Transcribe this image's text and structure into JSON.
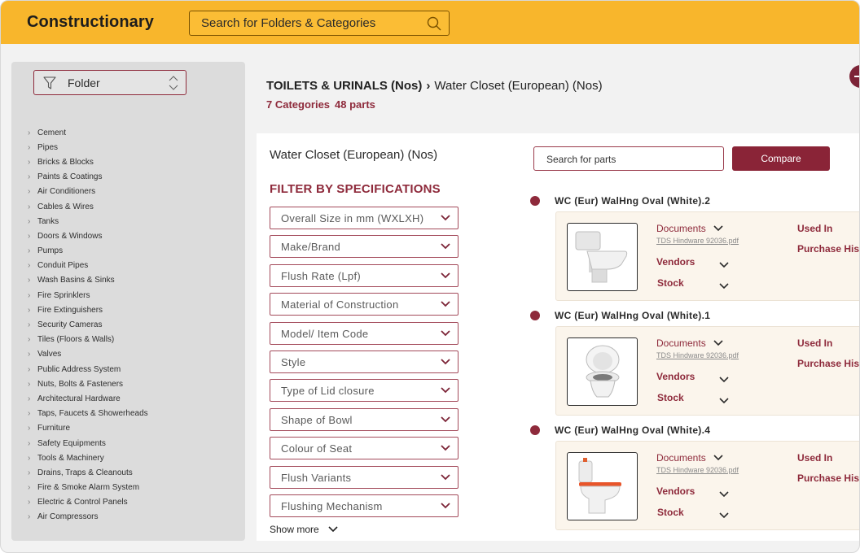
{
  "header": {
    "logo": "Constructionary",
    "search_placeholder": "Search for Folders & Categories"
  },
  "sidebar": {
    "folder_label": "Folder",
    "categories": [
      "Cement",
      "Pipes",
      "Bricks & Blocks",
      "Paints & Coatings",
      "Air Conditioners",
      "Cables & Wires",
      "Tanks",
      "Doors & Windows",
      "Pumps",
      "Conduit Pipes",
      "Wash Basins & Sinks",
      "Fire Sprinklers",
      "Fire Extinguishers",
      "Security Cameras",
      "Tiles (Floors & Walls)",
      "Valves",
      "Public Address System",
      "Nuts, Bolts & Fasteners",
      "Architectural Hardware",
      "Taps, Faucets & Showerheads",
      "Furniture",
      "Safety Equipments",
      "Tools & Machinery",
      "Drains, Traps & Cleanouts",
      "Fire & Smoke Alarm System",
      "Electric & Control Panels",
      "Air Compressors"
    ]
  },
  "breadcrumb": {
    "parent": "TOILETS & URINALS (Nos)",
    "separator": "›",
    "current": "Water Closet (European) (Nos)",
    "categories_count": "7 Categories",
    "parts_count": "48 parts"
  },
  "main": {
    "subtitle": "Water Closet (European) (Nos)",
    "filter_heading": "FILTER BY SPECIFICATIONS",
    "filters": [
      "Overall Size in mm (WXLXH)",
      "Make/Brand",
      "Flush Rate (Lpf)",
      "Material of Construction",
      "Model/ Item Code",
      "Style",
      "Type of Lid closure",
      "Shape of Bowl",
      "Colour of Seat",
      "Flush Variants",
      "Flushing Mechanism"
    ],
    "show_more": "Show more",
    "parts_search_placeholder": "Search for parts",
    "compare_label": "Compare"
  },
  "parts": [
    {
      "name": "WC (Eur) WalHng Oval (White).2",
      "documents": "Documents",
      "file": "TDS Hindware 92036.pdf",
      "vendors": "Vendors",
      "stock": "Stock",
      "used_in": "Used In",
      "purchase": "Purchase Hist"
    },
    {
      "name": "WC (Eur) WalHng Oval (White).1",
      "documents": "Documents",
      "file": "TDS Hindware 92036.pdf",
      "vendors": "Vendors",
      "stock": "Stock",
      "used_in": "Used In",
      "purchase": "Purchase Hist"
    },
    {
      "name": "WC (Eur) WalHng Oval (White).4",
      "documents": "Documents",
      "file": "TDS Hindware 92036.pdf",
      "vendors": "Vendors",
      "stock": "Stock",
      "used_in": "Used In",
      "purchase": "Purchase Hist"
    }
  ],
  "colors": {
    "header_bg": "#f8b62c",
    "brand_maroon": "#8e2a3b",
    "compare_bg": "#8a2437",
    "card_bg": "#fbf5ec"
  },
  "icons": {
    "search": "search-icon",
    "filter": "funnel-icon",
    "chevron": "chevron-down-icon",
    "sort": "up-down-chevron-icon",
    "bullet": "dot-icon",
    "toilet": "toilet-image"
  }
}
